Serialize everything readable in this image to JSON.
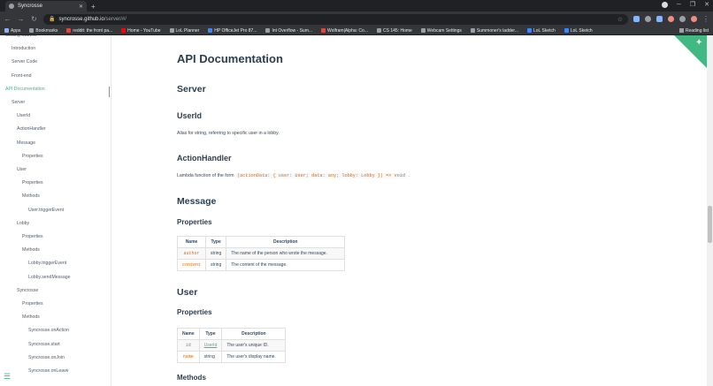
{
  "browser": {
    "tab_title": "Syncrosse",
    "url_host": "syncrosse.github.io",
    "url_path": "/server/#/",
    "new_tab": "+",
    "bookmarks": [
      {
        "label": "Apps",
        "icon": "grid"
      },
      {
        "label": "Bookmarks",
        "icon": "star"
      },
      {
        "label": "reddit: the front pa...",
        "icon": "red"
      },
      {
        "label": "Home - YouTube",
        "icon": "yt"
      },
      {
        "label": "LoL Planner",
        "icon": "plain"
      },
      {
        "label": "HP OfficeJet Pro 87...",
        "icon": "blue"
      },
      {
        "label": "Int Overflow - Sum...",
        "icon": "plain"
      },
      {
        "label": "Wolfram|Alpha: Co...",
        "icon": "red"
      },
      {
        "label": "CS 145: Home",
        "icon": "plain"
      },
      {
        "label": "Webcam Settings",
        "icon": "plain"
      },
      {
        "label": "Summoner's ladder...",
        "icon": "plain"
      },
      {
        "label": "LoL Sketch",
        "icon": "blue"
      },
      {
        "label": "LoL Sketch",
        "icon": "blue"
      }
    ],
    "reading_list": "Reading list"
  },
  "sidebar": {
    "items": [
      {
        "label": "Getting Started",
        "indent": 0,
        "style": "dim"
      },
      {
        "label": "Introduction",
        "indent": 1,
        "style": "dim"
      },
      {
        "label": "Server Code",
        "indent": 1,
        "style": "dim"
      },
      {
        "label": "Front-end",
        "indent": 1,
        "style": "dim"
      },
      {
        "label": "API Documentation",
        "indent": 0,
        "style": "active"
      },
      {
        "label": "Server",
        "indent": 1,
        "style": "dim"
      },
      {
        "label": "UserId",
        "indent": 2,
        "style": "dim"
      },
      {
        "label": "ActionHandler",
        "indent": 2,
        "style": "dim"
      },
      {
        "label": "Message",
        "indent": 2,
        "style": "dim"
      },
      {
        "label": "Properties",
        "indent": 3,
        "style": "dim"
      },
      {
        "label": "User",
        "indent": 2,
        "style": "dim"
      },
      {
        "label": "Properties",
        "indent": 3,
        "style": "dim"
      },
      {
        "label": "Methods",
        "indent": 3,
        "style": "dim"
      },
      {
        "label": "User.triggerEvent",
        "indent": 4,
        "style": "dim"
      },
      {
        "label": "Lobby",
        "indent": 2,
        "style": "dim"
      },
      {
        "label": "Properties",
        "indent": 3,
        "style": "dim"
      },
      {
        "label": "Methods",
        "indent": 3,
        "style": "dim"
      },
      {
        "label": "Lobby.triggerEvent",
        "indent": 4,
        "style": "dim"
      },
      {
        "label": "Lobby.sendMessage",
        "indent": 4,
        "style": "dim"
      },
      {
        "label": "Syncrosse",
        "indent": 2,
        "style": "dim"
      },
      {
        "label": "Properties",
        "indent": 3,
        "style": "dim"
      },
      {
        "label": "Methods",
        "indent": 3,
        "style": "dim"
      },
      {
        "label": "Syncrosse.onAction",
        "indent": 4,
        "style": "dim"
      },
      {
        "label": "Syncrosse.start",
        "indent": 4,
        "style": "dim"
      },
      {
        "label": "Syncrosse.onJoin",
        "indent": 4,
        "style": "dim"
      },
      {
        "label": "Syncrosse.onLeave",
        "indent": 4,
        "style": "dim"
      }
    ]
  },
  "content": {
    "title": "API Documentation",
    "server_heading": "Server",
    "userid_heading": "UserId",
    "userid_text": "Alias for string, referring to specific user in a lobby.",
    "actionhandler_heading": "ActionHandler",
    "actionhandler_text": "Lambda function of the form",
    "actionhandler_code": "(actionData: { user: User; data: any; lobby: Lobby }) => void",
    "actionhandler_end": ".",
    "message_heading": "Message",
    "message_props_heading": "Properties",
    "message_table": {
      "headers": [
        "Name",
        "Type",
        "Description"
      ],
      "rows": [
        {
          "name": "author",
          "type": "string",
          "desc": "The name of the person who wrote the message."
        },
        {
          "name": "content",
          "type": "string",
          "desc": "The content of the message."
        }
      ]
    },
    "user_heading": "User",
    "user_props_heading": "Properties",
    "user_table": {
      "headers": [
        "Name",
        "Type",
        "Description"
      ],
      "rows": [
        {
          "name": "id",
          "type": "UserId",
          "desc": "The user's unique ID."
        },
        {
          "name": "name",
          "type": "string",
          "desc": "The user's display name."
        }
      ]
    },
    "methods_heading": "Methods"
  },
  "colors": {
    "accent": "#42b983",
    "code": "#e96900",
    "heading": "#2c3e50"
  }
}
